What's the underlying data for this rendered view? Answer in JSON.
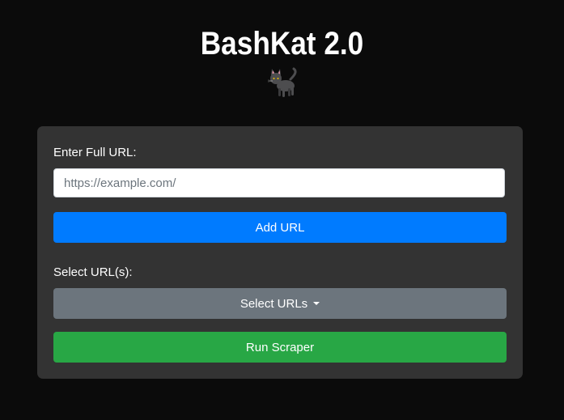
{
  "header": {
    "title": "BashKat 2.0"
  },
  "form": {
    "url_label": "Enter Full URL:",
    "url_input": {
      "placeholder": "https://example.com/",
      "value": ""
    },
    "add_button_label": "Add URL",
    "select_label": "Select URL(s):",
    "select_button_label": "Select URLs",
    "run_button_label": "Run Scraper"
  },
  "colors": {
    "background": "#0b0b0b",
    "card": "#333333",
    "primary": "#007bff",
    "secondary": "#6c757d",
    "success": "#28a745"
  },
  "icons": {
    "cat": "cat-icon",
    "dropdown": "caret-down-icon"
  }
}
